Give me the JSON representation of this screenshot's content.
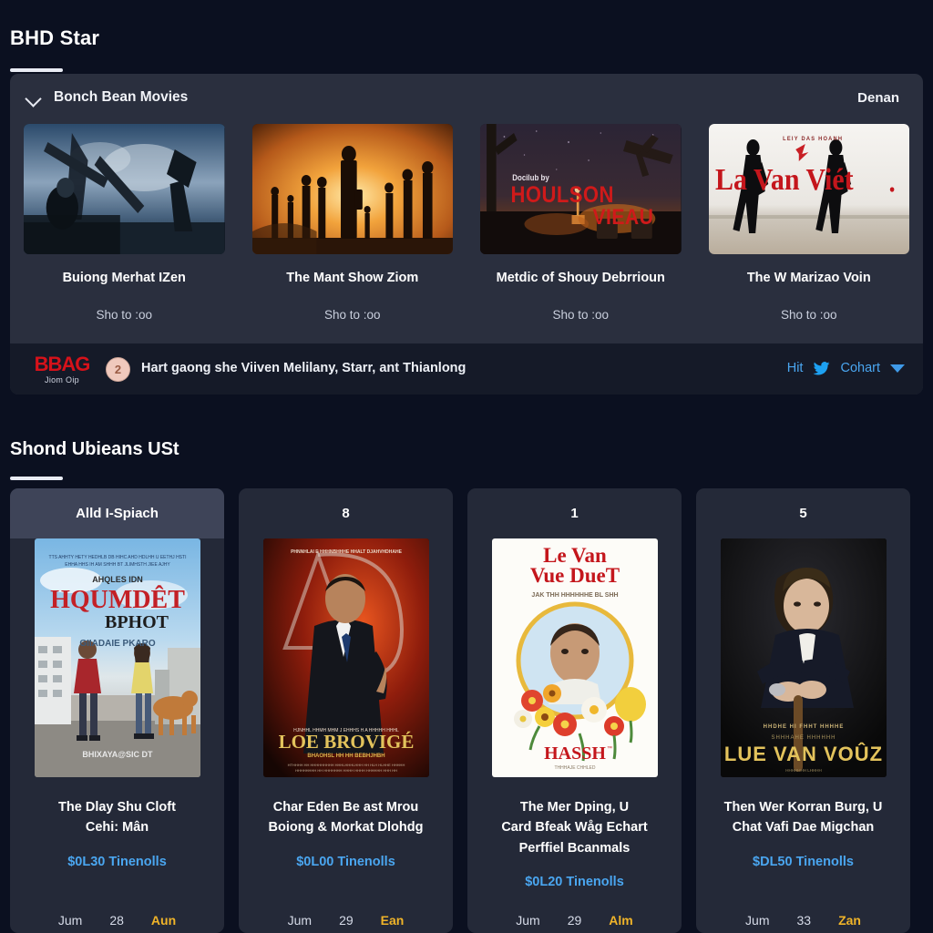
{
  "section1": {
    "title": "BHD Star",
    "panel": {
      "expander_label": "Bonch Bean Movies",
      "expander_icon": "chevron-down-icon",
      "right_label": "Denan"
    },
    "movies": [
      {
        "caption": "Buiong Merhat IZen",
        "showtime": "Sho to :oo",
        "art": "rig-sea",
        "poster_text": ""
      },
      {
        "caption": "The Mant Show Ziom",
        "showtime": "Sho to :oo",
        "art": "sunset-crowd",
        "poster_text": ""
      },
      {
        "caption": "Metdic of Shouy Debrrioun",
        "showtime": "Sho to :oo",
        "art": "night-city",
        "poster_text": "HOULSON VIEAU",
        "poster_kicker": "Docilub by"
      },
      {
        "caption": "The W Marizao Voin",
        "showtime": "Sho to :oo",
        "art": "two-men",
        "poster_text": "La Van Viét",
        "poster_kicker": "LEIY DAS HOANH"
      }
    ],
    "banner": {
      "logo_main": "BBAG",
      "logo_sub": "Jiom Oip",
      "avatar_badge": "2",
      "text": "Hart gaong she Viiven Melilany, Starr, ant Thianlong",
      "link1": "Hit",
      "bird_icon": "twitter-bird-icon",
      "link2": "Cohart",
      "caret_icon": "caret-down-icon"
    }
  },
  "section2": {
    "title": "Shond Ubieans USt",
    "cards": [
      {
        "head": "Alld I-Spiach",
        "art": "street-couple",
        "poster_text": "HQUMDÊT BPHOT",
        "poster_kicker": "GIIADAIE PKARO",
        "title_line1": "The Dlay Shu Cloft",
        "title_line2": "Cehi: Mân",
        "price": "$0L30 Tinenolls",
        "foot_left": "Jum",
        "foot_mid": "28",
        "foot_right": "Aun"
      },
      {
        "head": "8",
        "art": "red-man",
        "poster_text": "LOE BROVIGÉ",
        "poster_kicker": "",
        "title_line1": "Char Eden Be ast Mrou",
        "title_line2": "Boiong & Morkat Dlohdg",
        "price": "$0L00 Tinenolls",
        "foot_left": "Jum",
        "foot_mid": "29",
        "foot_right": "Ean"
      },
      {
        "head": "1",
        "art": "flowers-man",
        "poster_text": "Le Van Vue DueT",
        "poster_kicker": "HASSH",
        "title_line1": "The Mer Dping, U",
        "title_line2": "Card Bfeak Wåg Echart",
        "title_line3": "Perffiel Bcanmals",
        "price": "$0L20 Tinenolls",
        "foot_left": "Jum",
        "foot_mid": "29",
        "foot_right": "Alm"
      },
      {
        "head": "5",
        "art": "dark-man-cane",
        "poster_text": "LUE VAN VOÛZ",
        "poster_kicker": "",
        "title_line1": "Then Wer Korran Burg, U",
        "title_line2": "Chat Vafi Dae Migchan",
        "price": "$DL50 Tinenolls",
        "foot_left": "Jum",
        "foot_mid": "33",
        "foot_right": "Zan"
      }
    ]
  },
  "colors": {
    "page_bg": "#0b1020",
    "panel_bg": "#2a2f3e",
    "card_bg": "#242938",
    "accent_blue": "#4aa6f0",
    "accent_amber": "#f0b429",
    "logo_red": "#d6121a"
  }
}
